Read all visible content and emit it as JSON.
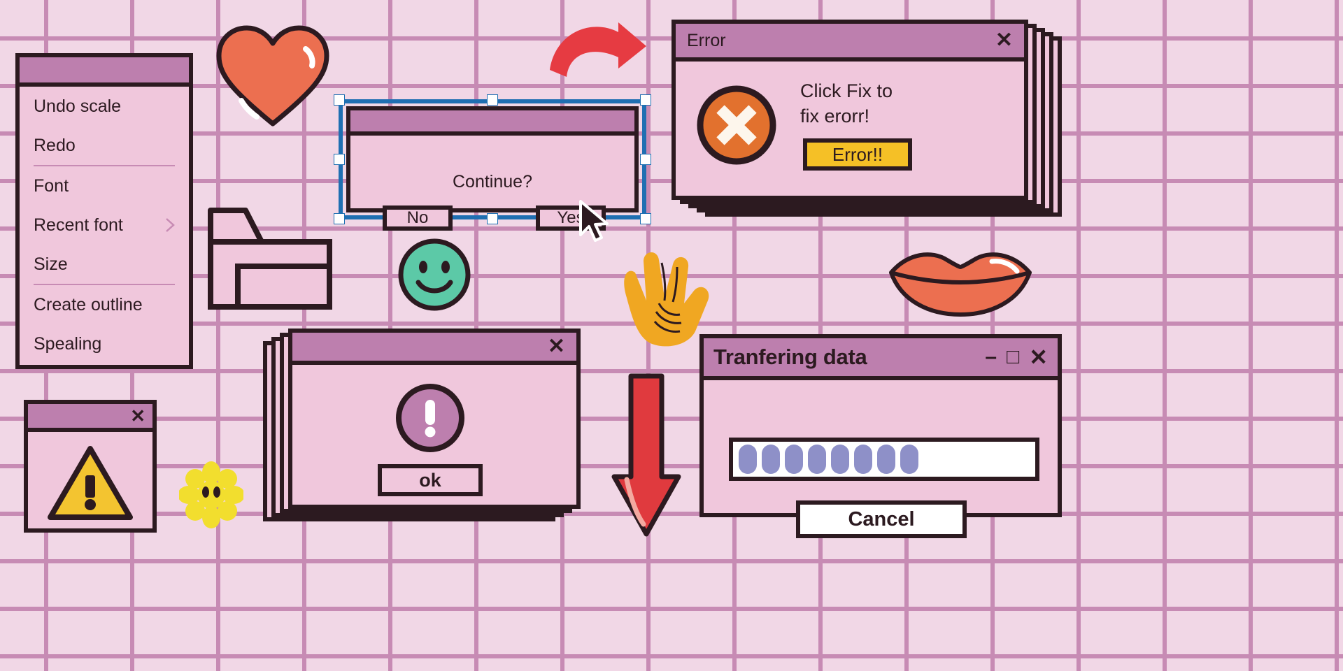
{
  "theme": {
    "bg": "#F1D7E6",
    "grid_line": "#C78BB4",
    "window_face": "#F0C7DC",
    "titlebar": "#BD7FAE",
    "outline": "#2C1A20",
    "selection_blue": "#1F6FB2",
    "error_orange": "#E2712E",
    "warning_yellow": "#F3C430",
    "button_yellow": "#F5C026",
    "progress_violet": "#8E90C8",
    "heart_red": "#EC6F50",
    "arrow_red": "#E63B42",
    "smiley_green": "#5CC9A7",
    "hand_orange": "#F0A722",
    "lips_coral": "#EC6F50",
    "flower_yellow": "#F2DE2E"
  },
  "context_menu": {
    "name": "edit-context-menu",
    "items": [
      {
        "label": "Undo scale",
        "separator_after": false,
        "submenu": false
      },
      {
        "label": "Redo",
        "separator_after": true,
        "submenu": false
      },
      {
        "label": "Font",
        "separator_after": false,
        "submenu": false
      },
      {
        "label": "Recent font",
        "separator_after": false,
        "submenu": true
      },
      {
        "label": "Size",
        "separator_after": true,
        "submenu": false
      },
      {
        "label": "Create outline",
        "separator_after": false,
        "submenu": false
      },
      {
        "label": "Spealing",
        "separator_after": false,
        "submenu": false
      }
    ]
  },
  "continue_dialog": {
    "title": "",
    "message": "Continue?",
    "buttons": [
      {
        "label": "No"
      },
      {
        "label": "Yes"
      }
    ],
    "selected": true,
    "handle_count": 8
  },
  "error_window": {
    "title": "Error",
    "close_label": "✕",
    "icon": "error-circle-x-icon",
    "message_lines": [
      "Click Fix to",
      "fix erorr!"
    ],
    "action_button": "Error!!",
    "stack_copies": 4
  },
  "ok_dialog": {
    "title": "",
    "close_label": "✕",
    "icon": "exclamation-circle-icon",
    "button_label": "ok",
    "stack_copies": 3
  },
  "warning_window": {
    "title": "",
    "close_label": "✕",
    "icon": "warning-triangle-icon"
  },
  "transfer_window": {
    "title": "Tranfering data",
    "minimize_label": "–",
    "maximize_label": "□",
    "close_label": "✕",
    "progress_pills": 8,
    "progress_total_slots": 13,
    "cancel_label": "Cancel"
  },
  "decorations": [
    {
      "name": "heart-sticker",
      "kind": "heart"
    },
    {
      "name": "curved-arrow-sticker",
      "kind": "curved-arrow"
    },
    {
      "name": "folder-icon",
      "kind": "folder"
    },
    {
      "name": "smiley-face-sticker",
      "kind": "smiley"
    },
    {
      "name": "peace-hand-sticker",
      "kind": "peace-hand"
    },
    {
      "name": "lips-sticker",
      "kind": "lips"
    },
    {
      "name": "down-arrow-sticker",
      "kind": "down-arrow"
    },
    {
      "name": "daisy-flower-sticker",
      "kind": "flower"
    },
    {
      "name": "mouse-cursor",
      "kind": "cursor"
    }
  ]
}
